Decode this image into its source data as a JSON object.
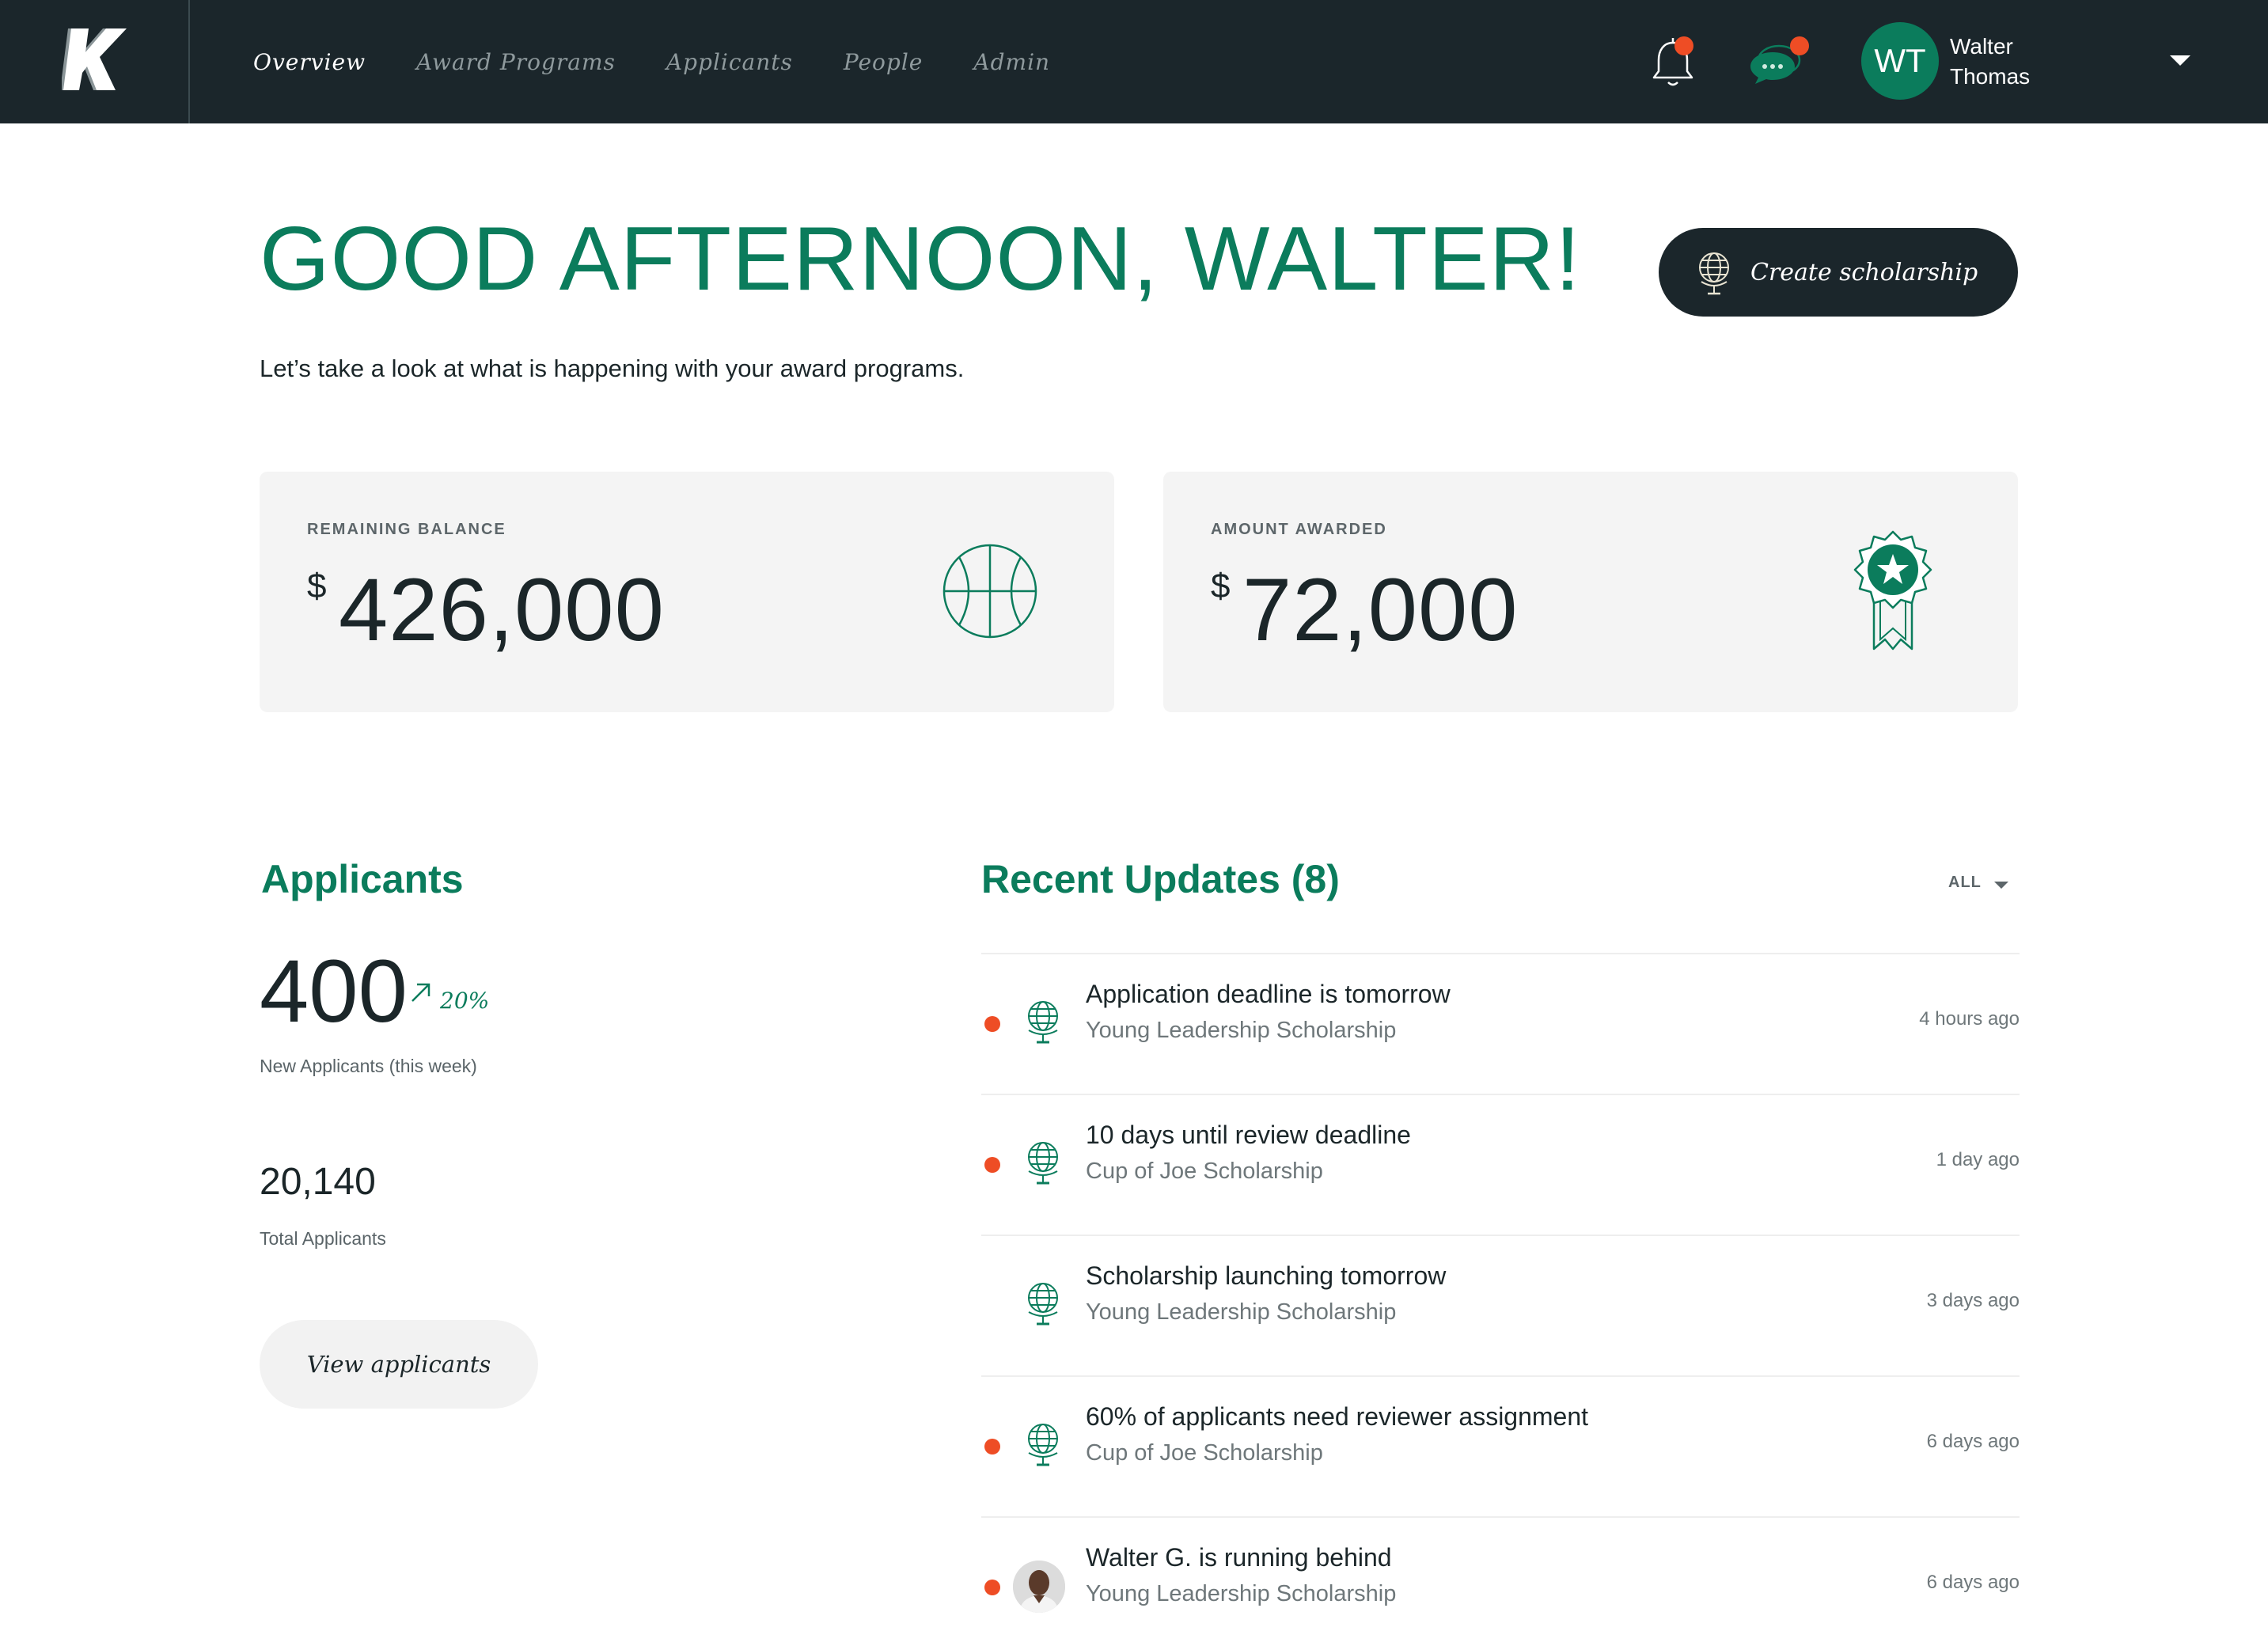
{
  "nav": {
    "items": [
      {
        "label": "Overview",
        "active": true
      },
      {
        "label": "Award Programs",
        "active": false
      },
      {
        "label": "Applicants",
        "active": false
      },
      {
        "label": "People",
        "active": false
      },
      {
        "label": "Admin",
        "active": false
      }
    ]
  },
  "header": {
    "user": {
      "initials": "WT",
      "first_name": "Walter",
      "last_name": "Thomas"
    },
    "icons": [
      "bell-icon",
      "chat-icon",
      "chevron-down-icon"
    ]
  },
  "greeting": {
    "title": "GOOD AFTERNOON, WALTER!",
    "subtitle": "Let’s take a look at what is happening with your award programs.",
    "create_button": "Create scholarship"
  },
  "stats": [
    {
      "label": "REMAINING BALANCE",
      "currency": "$",
      "amount": "426,000",
      "icon": "basketball-icon"
    },
    {
      "label": "AMOUNT AWARDED",
      "currency": "$",
      "amount": "72,000",
      "icon": "award-ribbon-icon"
    }
  ],
  "applicants": {
    "title": "Applicants",
    "new_count": "400",
    "change": "20%",
    "new_caption": "New Applicants (this week)",
    "total_count": "20,140",
    "total_caption": "Total Applicants",
    "view_button": "View applicants"
  },
  "recent_updates": {
    "title": "Recent Updates (8)",
    "filter": "ALL",
    "items": [
      {
        "title": "Application deadline is tomorrow",
        "subtitle": "Young Leadership Scholarship",
        "time": "4 hours ago",
        "unread": true,
        "icon": "globe-icon"
      },
      {
        "title": "10 days until review deadline",
        "subtitle": "Cup of Joe Scholarship",
        "time": "1 day ago",
        "unread": true,
        "icon": "globe-icon"
      },
      {
        "title": "Scholarship launching tomorrow",
        "subtitle": "Young Leadership Scholarship",
        "time": "3 days ago",
        "unread": false,
        "icon": "globe-icon"
      },
      {
        "title": "60% of applicants need reviewer assignment",
        "subtitle": "Cup of Joe Scholarship",
        "time": "6 days ago",
        "unread": true,
        "icon": "globe-icon"
      },
      {
        "title": "Walter G. is running behind",
        "subtitle": "Young Leadership Scholarship",
        "time": "6 days ago",
        "unread": true,
        "icon": "avatar-photo"
      }
    ]
  },
  "colors": {
    "brand_green": "#0b7c5c",
    "topbar": "#1b262b",
    "notification": "#ee4d25"
  }
}
